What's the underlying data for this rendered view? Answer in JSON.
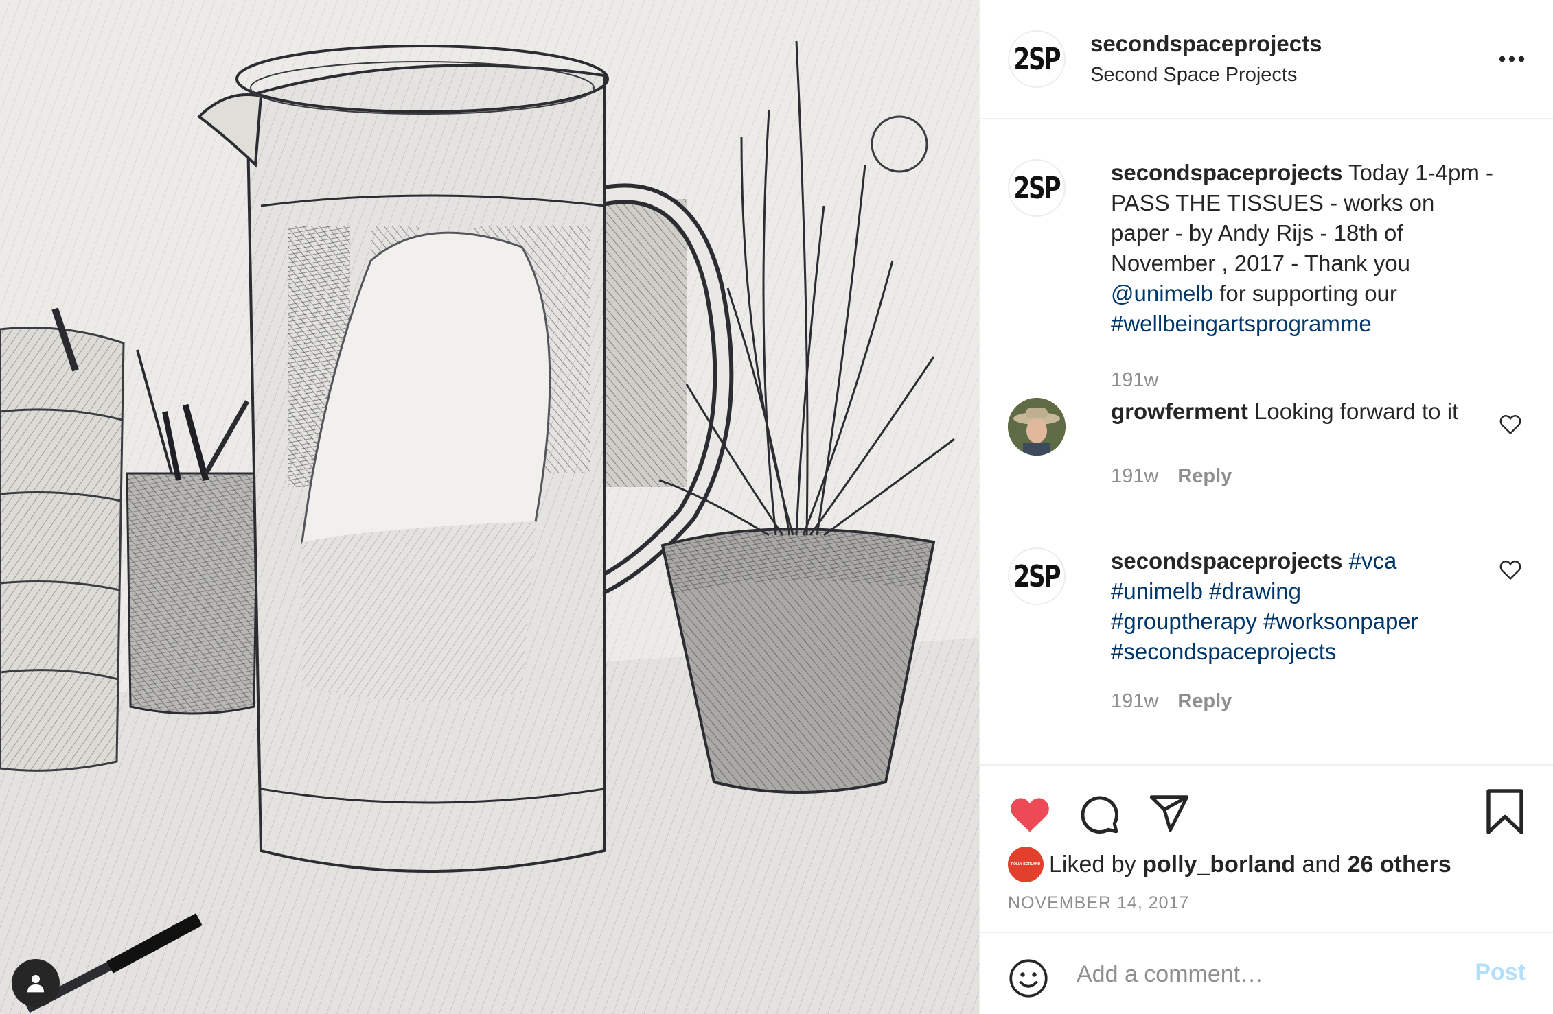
{
  "post": {
    "image_alt": "Ink drawing of a glass jug, pen pot and potted plant",
    "header": {
      "avatar_text": "2SP",
      "username": "secondspaceprojects",
      "full_name": "Second Space Projects"
    },
    "caption": {
      "avatar_text": "2SP",
      "username": "secondspaceprojects",
      "text_1": " Today 1-4pm - PASS THE TISSUES - works on paper - by Andy Rijs - 18th of November , 2017 - Thank you ",
      "mention": "@unimelb",
      "text_2": " for supporting our ",
      "hashtag": "#wellbeingartsprogramme",
      "time": "191w"
    },
    "comments": [
      {
        "username": "growferment",
        "text": " Looking forward to it",
        "time": "191w",
        "reply_label": "Reply"
      },
      {
        "avatar_text": "2SP",
        "username": "secondspaceprojects",
        "tags": [
          "#vca",
          "#unimelb",
          "#drawing",
          "#grouptherapy",
          "#worksonpaper",
          "#secondspaceprojects"
        ],
        "time": "191w",
        "reply_label": "Reply"
      }
    ],
    "likes": {
      "liked_by_label": "Liked by ",
      "liker": "polly_borland",
      "and_label": " and ",
      "others": "26 others",
      "liker_avatar_text": "POLLY BORLAND"
    },
    "date": "NOVEMBER 14, 2017",
    "add_comment": {
      "placeholder": "Add a comment…",
      "post_label": "Post"
    },
    "colors": {
      "like_red": "#ed4956",
      "link_blue": "#00376b",
      "post_disabled": "#b2dffc",
      "muted": "#8e8e8e"
    },
    "icons": {
      "more": "more-horizontal-icon",
      "like": "heart-filled-icon",
      "comment": "comment-bubble-icon",
      "share": "paper-plane-icon",
      "save": "bookmark-icon",
      "emoji": "smiley-icon",
      "user_tag": "user-icon"
    }
  }
}
